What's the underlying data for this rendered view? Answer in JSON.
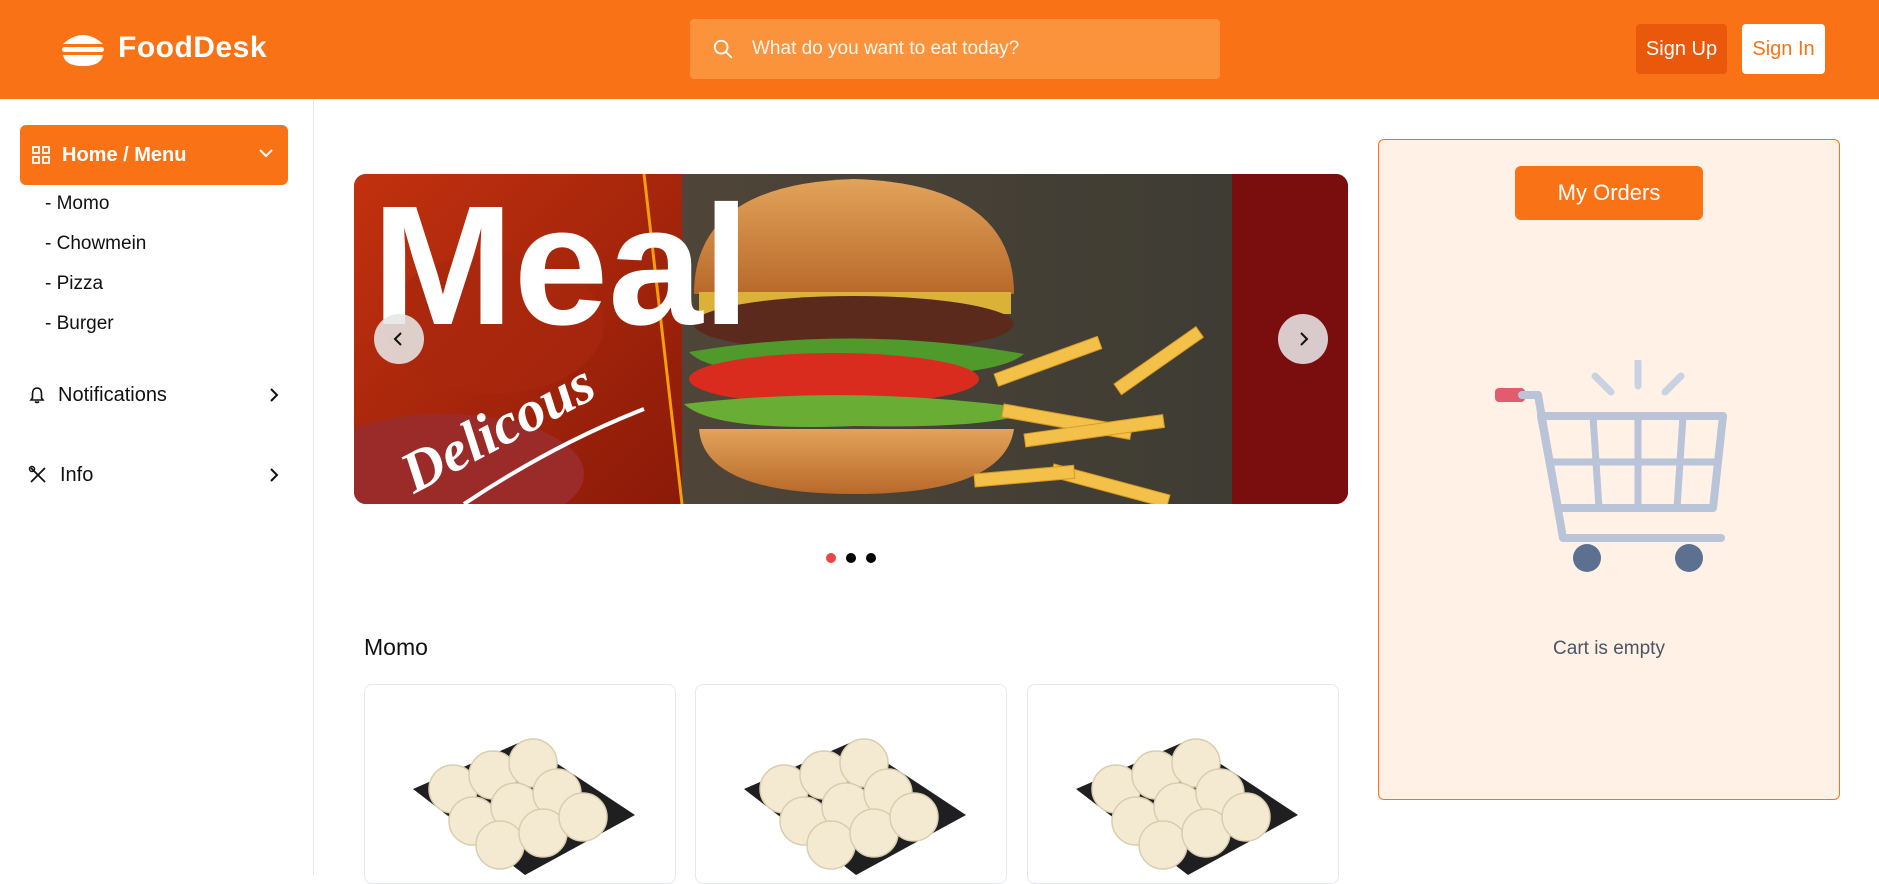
{
  "header": {
    "brand": "FoodDesk",
    "search_placeholder": "What do you want to eat today?",
    "signup_label": "Sign Up",
    "signin_label": "Sign In"
  },
  "sidebar": {
    "active_item": "Home / Menu",
    "sub_items": [
      "- Momo",
      "- Chowmein",
      "- Pizza",
      "- Burger"
    ],
    "items": [
      "Notifications",
      "Info"
    ]
  },
  "banner": {
    "headline": "Meal",
    "tagline": "Delicous",
    "slides_total": 3,
    "active_slide": 1
  },
  "menu": {
    "section_title": "Momo",
    "card_count": 3
  },
  "orders": {
    "button_label": "My Orders",
    "empty_text": "Cart is empty"
  },
  "colors": {
    "primary": "#f97316",
    "primary_dark": "#ea580c",
    "panel_bg": "#fff1e6",
    "dot_active": "#ef4444"
  }
}
